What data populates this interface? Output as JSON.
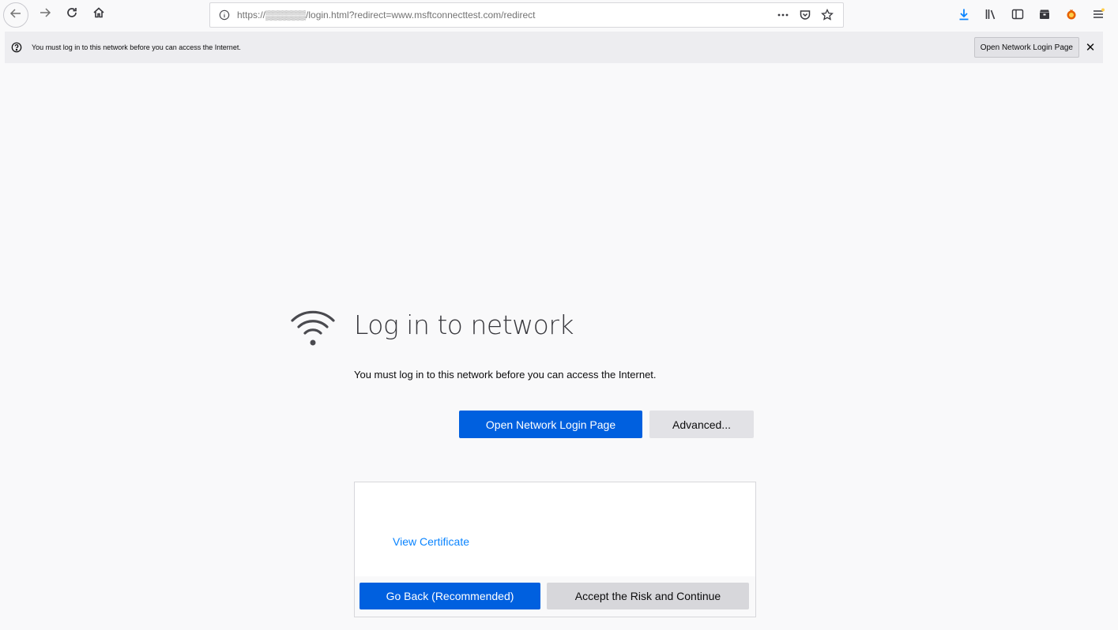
{
  "toolbar": {
    "url": "https://▒▒▒▒▒▒/login.html?redirect=www.msftconnecttest.com/redirect",
    "icons": {
      "back": "back-arrow-icon",
      "forward": "forward-arrow-icon",
      "reload": "reload-icon",
      "home": "home-icon",
      "info": "info-icon",
      "page_actions": "more-dots-icon",
      "pocket": "pocket-icon",
      "bookmark": "star-icon",
      "downloads": "download-arrow-icon",
      "library": "library-icon",
      "sidebar": "sidebar-icon",
      "containers": "containers-icon",
      "extension": "extension-icon",
      "menu": "hamburger-menu-icon"
    },
    "accent_download": "#0a84ff"
  },
  "notification": {
    "message": "You must log in to this network before you can access the Internet.",
    "button_label": "Open Network Login Page",
    "close_glyph": "✕"
  },
  "page": {
    "title": "Log in to network",
    "description": "You must log in to this network before you can access the Internet.",
    "primary_button": "Open Network Login Page",
    "secondary_button": "Advanced...",
    "advanced": {
      "cert_link": "View Certificate",
      "goback_button": "Go Back (Recommended)",
      "accept_button": "Accept the Risk and Continue"
    }
  },
  "colors": {
    "primary": "#0060df",
    "link": "#0a84ff",
    "background": "#f9f9fa"
  }
}
